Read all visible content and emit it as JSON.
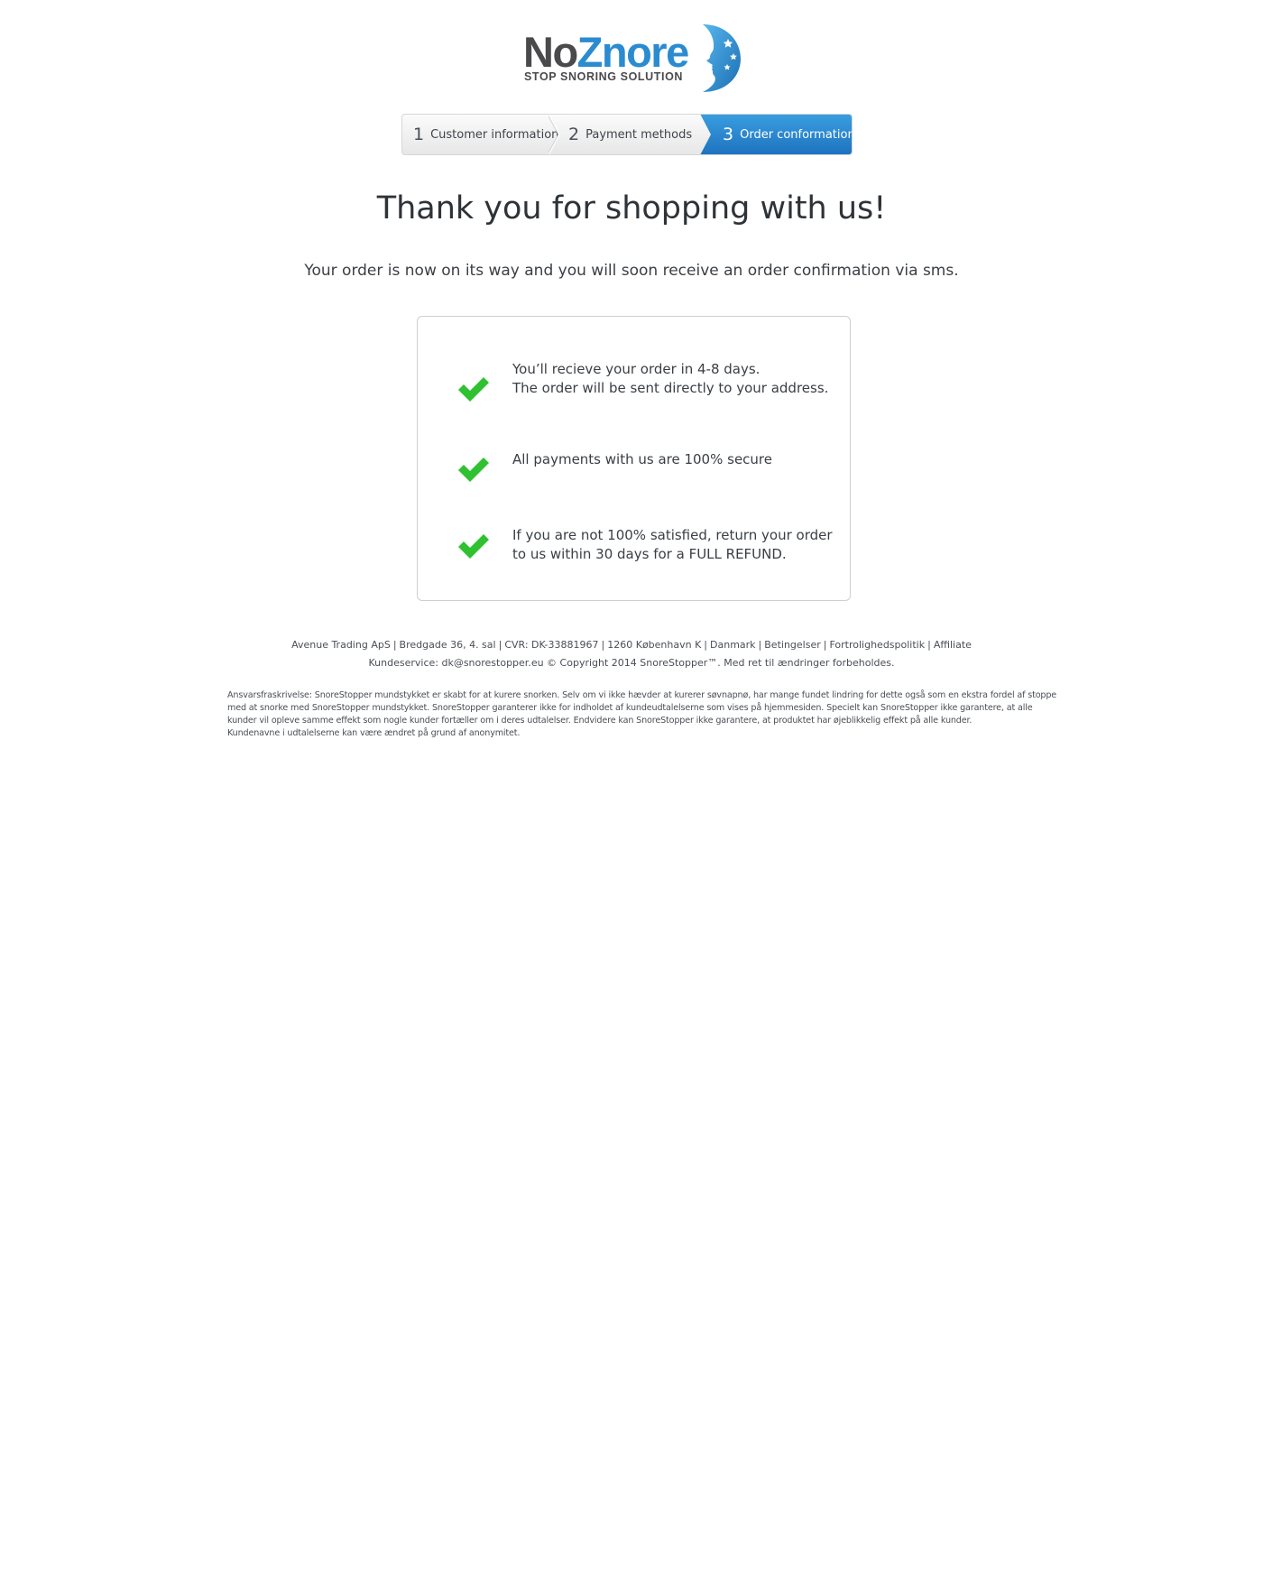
{
  "brand": {
    "name_part1": "No",
    "name_part2": "Znore",
    "tagline": "STOP SNORING SOLUTION",
    "primary_color": "#2b8bd0",
    "dark_color": "#4a4a4d"
  },
  "steps": [
    {
      "number": "1",
      "label": "Customer information",
      "active": false
    },
    {
      "number": "2",
      "label": "Payment methods",
      "active": false
    },
    {
      "number": "3",
      "label": "Order conformation",
      "active": true
    }
  ],
  "heading": "Thank you for shopping with us!",
  "subheading": "Your order is now on its way and you will soon receive an order confirmation via sms.",
  "benefits": [
    {
      "icon": "check-icon",
      "lines": [
        "You’ll recieve your order  in 4-8 days.",
        "The order will be sent directly to your address."
      ]
    },
    {
      "icon": "check-icon",
      "lines": [
        "All payments with us are 100% secure"
      ]
    },
    {
      "icon": "check-icon",
      "lines": [
        "If you are not 100% satisfied, return your order",
        "to us within 30 days for a FULL REFUND."
      ]
    }
  ],
  "check_color": "#2fc12f",
  "footer": {
    "company": "Avenue Trading ApS",
    "address": "Bredgade 36, 4. sal",
    "cvr": "CVR: DK-33881967",
    "city": "1260 København K",
    "country": "Danmark",
    "link_terms": "Betingelser",
    "link_privacy": "Fortrolighedspolitik",
    "link_affiliate": "Affiliate",
    "service": "Kundeservice: dk@snorestopper.eu © Copyright 2014 SnoreStopper™. Med ret til ændringer forbeholdes."
  },
  "disclaimer": [
    "Ansvarsfraskrivelse: SnoreStopper mundstykket er skabt for at kurere snorken. Selv om vi ikke hævder at kurerer søvnapnø, har mange fundet lindring for dette også som en ekstra fordel af stoppe",
    "med at snorke med SnoreStopper mundstykket. SnoreStopper garanterer ikke for indholdet af kundeudtalelserne som vises på hjemmesiden. Specielt kan SnoreStopper ikke garantere, at alle",
    "kunder vil opleve samme effekt som nogle kunder fortæller om i deres udtalelser. Endvidere kan SnoreStopper ikke garantere, at produktet har øjeblikkelig effekt på alle kunder.",
    "Kundenavne i udtalelserne kan være ændret på grund af anonymitet."
  ]
}
